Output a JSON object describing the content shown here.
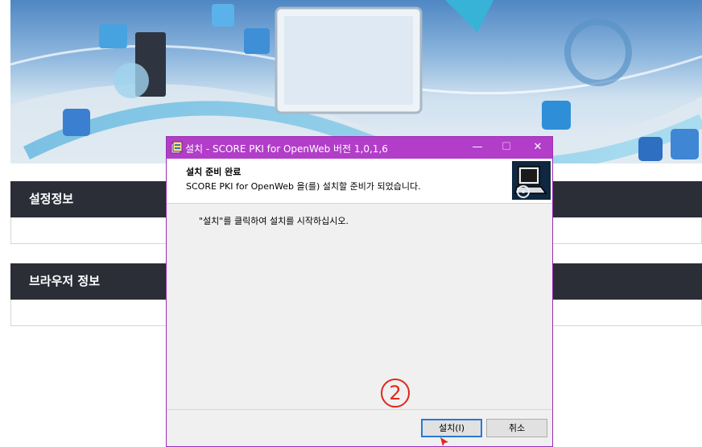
{
  "banner": {
    "alt": "technology network banner"
  },
  "sections": [
    {
      "title": "설정정보"
    },
    {
      "title": "브라우저 정보"
    }
  ],
  "dialog": {
    "title": "설치 - SCORE PKI for OpenWeb 버전 1,0,1,6",
    "controls": {
      "minimize": "—",
      "maximize": "☐",
      "close": "✕"
    },
    "header_title": "설치 준비 완료",
    "header_subtitle": "SCORE PKI for OpenWeb 을(를) 설치할 준비가 되었습니다.",
    "body_text": "\"설치\"를 클릭하여 설치를 시작하십시오.",
    "step_marker": "②",
    "buttons": {
      "install": "설치(I)",
      "cancel": "취소"
    }
  },
  "colors": {
    "titlebar": "#b23dc9",
    "section_header": "#2b2e37",
    "marker": "#e0261c",
    "focus": "#2a78d7"
  }
}
